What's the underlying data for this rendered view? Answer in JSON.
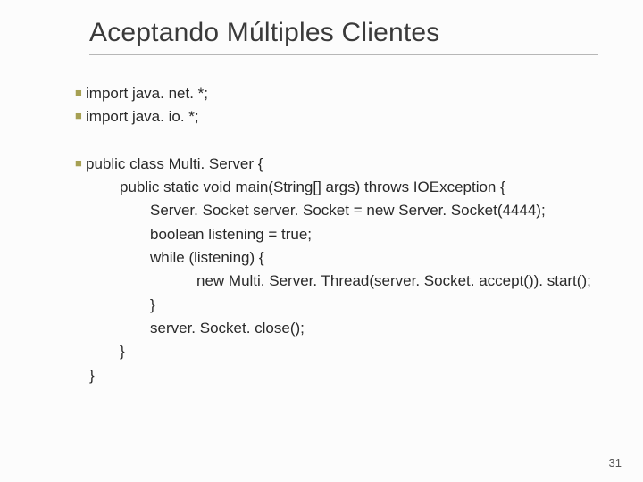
{
  "title": "Aceptando Múltiples Clientes",
  "lines": {
    "l1": "import java. net. *;",
    "l2": "import java. io. *;",
    "l3": "public class Multi. Server {",
    "l4": "public static void main(String[] args) throws IOException {",
    "l5": "Server. Socket server. Socket = new Server. Socket(4444);",
    "l6": "boolean listening = true;",
    "l7": "while (listening) {",
    "l8": "new Multi. Server. Thread(server. Socket. accept()). start();",
    "l9": "}",
    "l10": "server. Socket. close();",
    "l11": "}",
    "l12": "}"
  },
  "page_number": "31"
}
